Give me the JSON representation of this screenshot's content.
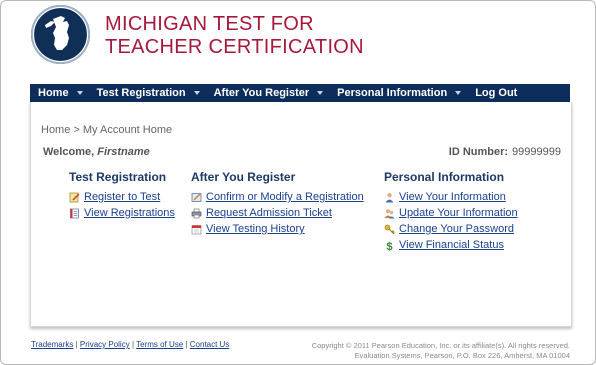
{
  "header": {
    "title_line1": "MICHIGAN TEST FOR",
    "title_line2": "TEACHER CERTIFICATION",
    "logo_icon": "michigan-seal-icon",
    "title_color": "#a6193b"
  },
  "nav": {
    "items": [
      {
        "label": "Home"
      },
      {
        "label": "Test Registration"
      },
      {
        "label": "After You Register"
      },
      {
        "label": "Personal Information"
      },
      {
        "label": "Log Out"
      }
    ],
    "bg_color": "#0d2d5c"
  },
  "breadcrumb": "Home > My Account Home",
  "welcome": {
    "prefix": "Welcome,",
    "name": "Firstname"
  },
  "id_number": {
    "label": "ID Number:",
    "value": "99999999"
  },
  "sections": [
    {
      "title": "Test Registration",
      "links": [
        {
          "label": "Register to Test",
          "icon": "pencil-note-icon"
        },
        {
          "label": "View Registrations",
          "icon": "document-list-icon"
        }
      ]
    },
    {
      "title": "After You Register",
      "links": [
        {
          "label": "Confirm or Modify a Registration",
          "icon": "edit-form-icon"
        },
        {
          "label": "Request Admission Ticket",
          "icon": "printer-icon"
        },
        {
          "label": "View Testing History",
          "icon": "calendar-icon"
        }
      ]
    },
    {
      "title": "Personal Information",
      "links": [
        {
          "label": "View Your Information",
          "icon": "person-icon"
        },
        {
          "label": "Update Your Information",
          "icon": "people-edit-icon"
        },
        {
          "label": "Change Your Password",
          "icon": "key-icon"
        },
        {
          "label": "View Financial Status",
          "icon": "dollar-icon"
        }
      ]
    }
  ],
  "footer": {
    "links": [
      "Trademarks",
      "Privacy Policy",
      "Terms of Use",
      "Contact Us"
    ],
    "copyright_line1": "Copyright © 2011 Pearson Education, Inc. or its affiliate(s). All rights reserved.",
    "copyright_line2": "Evaluation Systems, Pearson, P.O. Box 226, Amherst, MA 01004"
  }
}
